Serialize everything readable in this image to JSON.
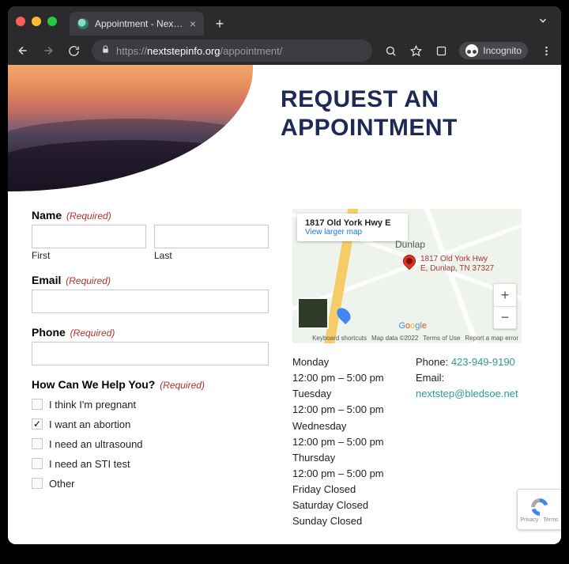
{
  "browser": {
    "tab_title": "Appointment - Next Step Reso",
    "url_host": "nextstepinfo.org",
    "url_path": "/appointment/",
    "url_scheme": "https://",
    "incognito_label": "Incognito"
  },
  "hero": {
    "title_line1": "REQUEST AN",
    "title_line2": "APPOINTMENT"
  },
  "form": {
    "required_text": "(Required)",
    "name": {
      "label": "Name",
      "first_sub": "First",
      "last_sub": "Last"
    },
    "email": {
      "label": "Email"
    },
    "phone": {
      "label": "Phone"
    },
    "help": {
      "label": "How Can We Help You?",
      "options": [
        {
          "label": "I think I'm pregnant",
          "checked": false
        },
        {
          "label": "I want an abortion",
          "checked": true
        },
        {
          "label": "I need an ultrasound",
          "checked": false
        },
        {
          "label": "I need an STI test",
          "checked": false
        },
        {
          "label": "Other",
          "checked": false
        }
      ]
    }
  },
  "map": {
    "address_short": "1817 Old York Hwy E",
    "view_larger": "View larger map",
    "city": "Dunlap",
    "pin_line1": "1817 Old York Hwy",
    "pin_line2": "E, Dunlap, TN 37327",
    "footer": {
      "shortcuts": "Keyboard shortcuts",
      "data": "Map data ©2022",
      "terms": "Terms of Use",
      "report": "Report a map error"
    }
  },
  "hours": {
    "monday_label": "Monday",
    "monday_time": "12:00 pm – 5:00 pm",
    "tuesday_label": "Tuesday",
    "tuesday_time": "12:00 pm – 5:00 pm",
    "wednesday_label": "Wednesday",
    "wednesday_time": "12:00 pm – 5:00 pm",
    "thursday_label": "Thursday",
    "thursday_time": "12:00 pm – 5:00 pm",
    "friday": "Friday Closed",
    "saturday": "Saturday Closed",
    "sunday": "Sunday Closed"
  },
  "contact": {
    "phone_label": "Phone: ",
    "phone": "423-949-9190",
    "email_label": "Email:",
    "email": "nextstep@bledsoe.net"
  },
  "recaptcha": {
    "line1": "Privacy",
    "line2": "Terms"
  }
}
